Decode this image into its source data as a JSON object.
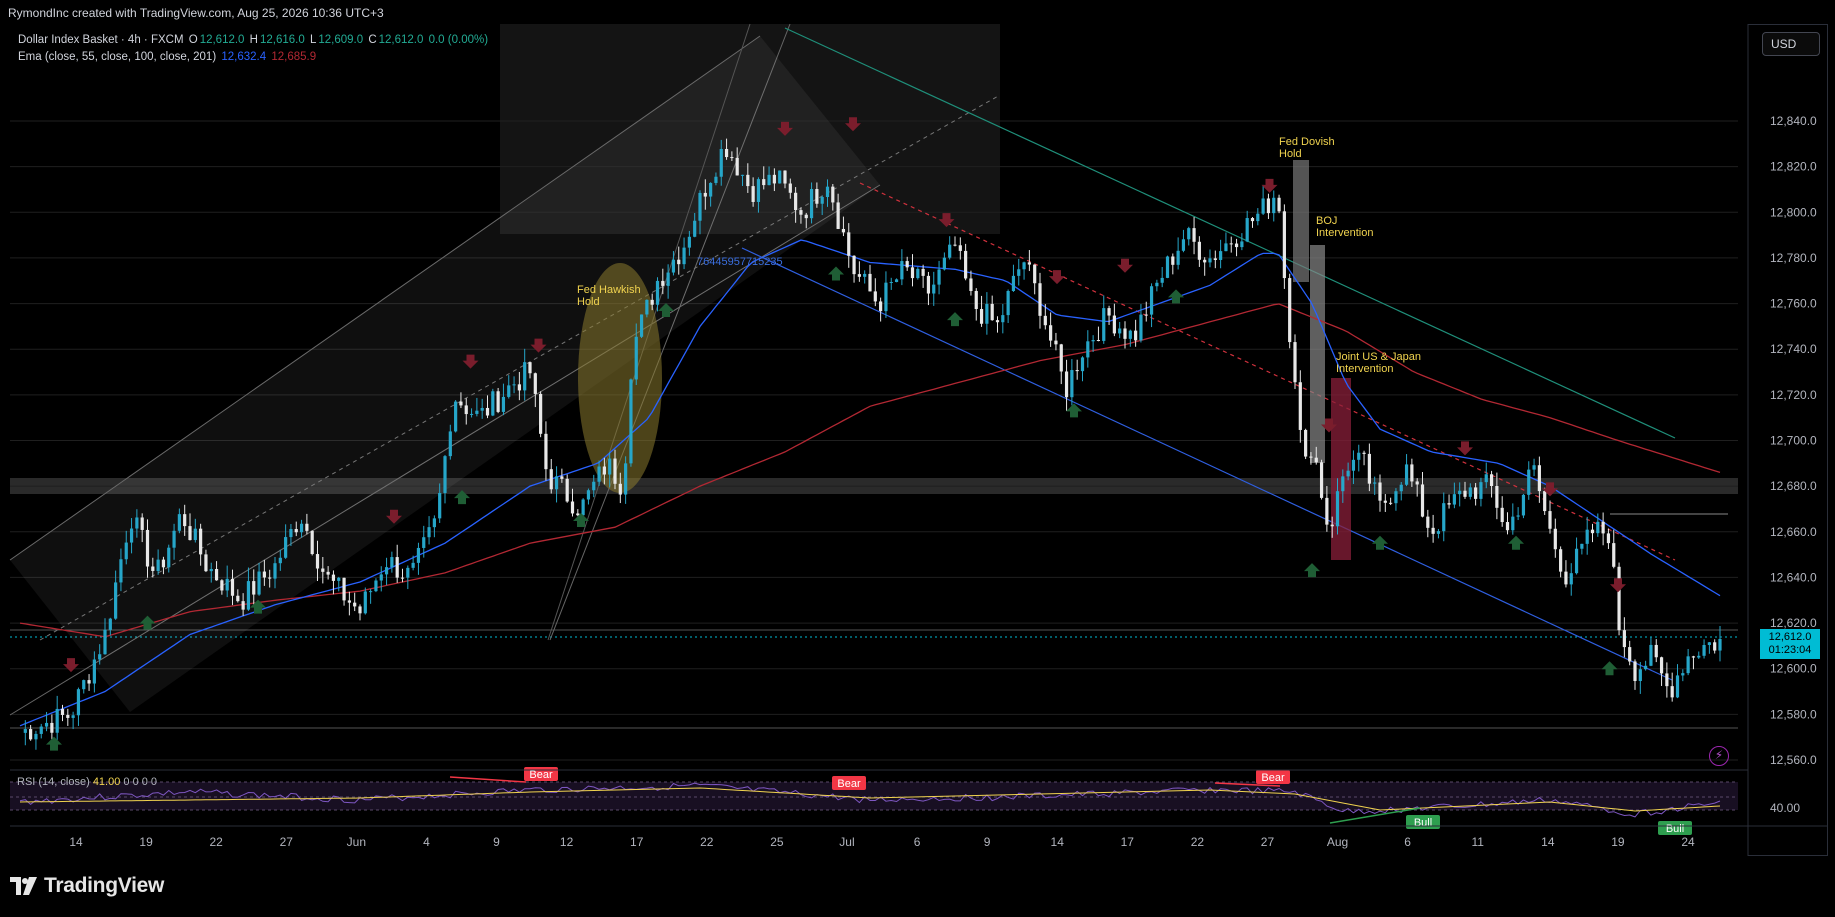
{
  "header": {
    "created_by": "RymondInc created with TradingView.com, Aug 25, 2026 10:36 UTC+3"
  },
  "legend": {
    "symbol": "Dollar Index Basket · 4h · FXCM",
    "open_label": "O",
    "open": "12,612.0",
    "high_label": "H",
    "high": "12,616.0",
    "low_label": "L",
    "low": "12,609.0",
    "close_label": "C",
    "close": "12,612.0",
    "change": "0.0 (0.00%)",
    "ema_label": "Ema (close, 55, close, 100, close, 201)",
    "ema_val1": "12,632.4",
    "ema_val2": "12,685.9"
  },
  "currency_button": "USD",
  "price_tag": {
    "price": "12,612.0",
    "countdown": "01:23:04"
  },
  "rsi": {
    "label": "RSI (14, close)",
    "value": "41.00",
    "tail": "0 0 0 0",
    "axis_value": "40.00"
  },
  "brand": {
    "name": "TradingView"
  },
  "colors": {
    "background": "#000000",
    "candle_up": "#26a6c9",
    "candle_down": "#e8e8e8",
    "ema55": "#2962ff",
    "ema100": "#b22833",
    "annotation_text": "#f0d34f",
    "price_tag": "#00bcd4",
    "rsi_line": "#7e57c2",
    "rsi_ma": "#f0d34f",
    "bear_label": "#f23645",
    "bull_label": "#2e9e4f"
  },
  "chart_data": {
    "type": "candlestick",
    "timeframe": "4h",
    "y_axis_ticks": [
      12840,
      12820,
      12800,
      12780,
      12760,
      12740,
      12720,
      12700,
      12680,
      12660,
      12640,
      12620,
      12600,
      12580,
      12560
    ],
    "y_axis_labels": [
      "12,840.0",
      "12,820.0",
      "12,800.0",
      "12,780.0",
      "12,760.0",
      "12,740.0",
      "12,720.0",
      "12,700.0",
      "12,680.0",
      "12,660.0",
      "12,640.0",
      "12,620.0",
      "12,600.0",
      "12,580.0",
      "12,560.0"
    ],
    "x_axis_labels": [
      "14",
      "19",
      "22",
      "27",
      "Jun",
      "4",
      "9",
      "12",
      "17",
      "22",
      "25",
      "Jul",
      "6",
      "9",
      "14",
      "17",
      "22",
      "27",
      "Aug",
      "6",
      "11",
      "14",
      "19",
      "24"
    ],
    "ylim": [
      12550,
      12850
    ],
    "price_path": [
      [
        0,
        12572
      ],
      [
        0.03,
        12580
      ],
      [
        0.05,
        12615
      ],
      [
        0.065,
        12668
      ],
      [
        0.08,
        12640
      ],
      [
        0.095,
        12668
      ],
      [
        0.11,
        12645
      ],
      [
        0.13,
        12630
      ],
      [
        0.15,
        12645
      ],
      [
        0.165,
        12668
      ],
      [
        0.18,
        12640
      ],
      [
        0.2,
        12625
      ],
      [
        0.215,
        12648
      ],
      [
        0.23,
        12640
      ],
      [
        0.245,
        12665
      ],
      [
        0.255,
        12720
      ],
      [
        0.27,
        12710
      ],
      [
        0.29,
        12725
      ],
      [
        0.3,
        12730
      ],
      [
        0.31,
        12685
      ],
      [
        0.33,
        12670
      ],
      [
        0.345,
        12690
      ],
      [
        0.355,
        12680
      ],
      [
        0.36,
        12740
      ],
      [
        0.375,
        12770
      ],
      [
        0.39,
        12785
      ],
      [
        0.405,
        12815
      ],
      [
        0.415,
        12830
      ],
      [
        0.43,
        12810
      ],
      [
        0.445,
        12815
      ],
      [
        0.46,
        12800
      ],
      [
        0.475,
        12815
      ],
      [
        0.49,
        12775
      ],
      [
        0.505,
        12760
      ],
      [
        0.52,
        12775
      ],
      [
        0.535,
        12765
      ],
      [
        0.55,
        12785
      ],
      [
        0.56,
        12760
      ],
      [
        0.575,
        12750
      ],
      [
        0.59,
        12780
      ],
      [
        0.6,
        12760
      ],
      [
        0.615,
        12722
      ],
      [
        0.625,
        12740
      ],
      [
        0.64,
        12755
      ],
      [
        0.655,
        12745
      ],
      [
        0.67,
        12770
      ],
      [
        0.685,
        12790
      ],
      [
        0.7,
        12780
      ],
      [
        0.715,
        12790
      ],
      [
        0.73,
        12800
      ],
      [
        0.74,
        12810
      ],
      [
        0.745,
        12760
      ],
      [
        0.75,
        12730
      ],
      [
        0.755,
        12685
      ],
      [
        0.76,
        12700
      ],
      [
        0.77,
        12660
      ],
      [
        0.78,
        12690
      ],
      [
        0.79,
        12690
      ],
      [
        0.8,
        12670
      ],
      [
        0.815,
        12688
      ],
      [
        0.83,
        12660
      ],
      [
        0.84,
        12670
      ],
      [
        0.85,
        12678
      ],
      [
        0.865,
        12680
      ],
      [
        0.875,
        12660
      ],
      [
        0.89,
        12688
      ],
      [
        0.9,
        12660
      ],
      [
        0.91,
        12640
      ],
      [
        0.925,
        12660
      ],
      [
        0.935,
        12660
      ],
      [
        0.94,
        12620
      ],
      [
        0.95,
        12600
      ],
      [
        0.96,
        12605
      ],
      [
        0.97,
        12590
      ],
      [
        0.98,
        12605
      ],
      [
        0.99,
        12610
      ],
      [
        1.0,
        12612
      ]
    ],
    "ema55": [
      [
        0,
        12575
      ],
      [
        0.05,
        12590
      ],
      [
        0.1,
        12615
      ],
      [
        0.15,
        12628
      ],
      [
        0.2,
        12638
      ],
      [
        0.25,
        12655
      ],
      [
        0.3,
        12680
      ],
      [
        0.34,
        12690
      ],
      [
        0.37,
        12710
      ],
      [
        0.4,
        12750
      ],
      [
        0.43,
        12778
      ],
      [
        0.46,
        12788
      ],
      [
        0.5,
        12778
      ],
      [
        0.55,
        12775
      ],
      [
        0.58,
        12770
      ],
      [
        0.61,
        12755
      ],
      [
        0.64,
        12752
      ],
      [
        0.67,
        12760
      ],
      [
        0.7,
        12768
      ],
      [
        0.73,
        12782
      ],
      [
        0.74,
        12782
      ],
      [
        0.76,
        12760
      ],
      [
        0.78,
        12725
      ],
      [
        0.8,
        12705
      ],
      [
        0.83,
        12695
      ],
      [
        0.87,
        12690
      ],
      [
        0.9,
        12680
      ],
      [
        0.93,
        12665
      ],
      [
        0.96,
        12650
      ],
      [
        1.0,
        12632
      ]
    ],
    "ema100": [
      [
        0,
        12620
      ],
      [
        0.05,
        12614
      ],
      [
        0.1,
        12625
      ],
      [
        0.15,
        12630
      ],
      [
        0.2,
        12634
      ],
      [
        0.25,
        12642
      ],
      [
        0.3,
        12655
      ],
      [
        0.35,
        12662
      ],
      [
        0.4,
        12680
      ],
      [
        0.45,
        12695
      ],
      [
        0.5,
        12715
      ],
      [
        0.55,
        12725
      ],
      [
        0.6,
        12735
      ],
      [
        0.65,
        12742
      ],
      [
        0.7,
        12752
      ],
      [
        0.74,
        12760
      ],
      [
        0.78,
        12748
      ],
      [
        0.82,
        12730
      ],
      [
        0.86,
        12718
      ],
      [
        0.9,
        12710
      ],
      [
        0.94,
        12700
      ],
      [
        1.0,
        12686
      ]
    ],
    "annotations": [
      {
        "text": "Fed Hawkish Hold",
        "line1": "Fed Hawkish",
        "line2": "Hold"
      },
      {
        "text": "Fed Dovish Hold",
        "line1": "Fed Dovish",
        "line2": "Hold"
      },
      {
        "text": "BOJ Intervention",
        "line1": "BOJ",
        "line2": "Intervention"
      },
      {
        "text": "Joint US & Japan Intervention",
        "line1": "Joint US & Japan",
        "line2": "Intervention"
      }
    ],
    "inline_number": "76445957715235",
    "current_price": 12612.0,
    "rsi_panel": {
      "labels": [
        "Bear",
        "Bear",
        "Bear",
        "Bull",
        "Bull"
      ],
      "level_label": "40.00"
    }
  }
}
